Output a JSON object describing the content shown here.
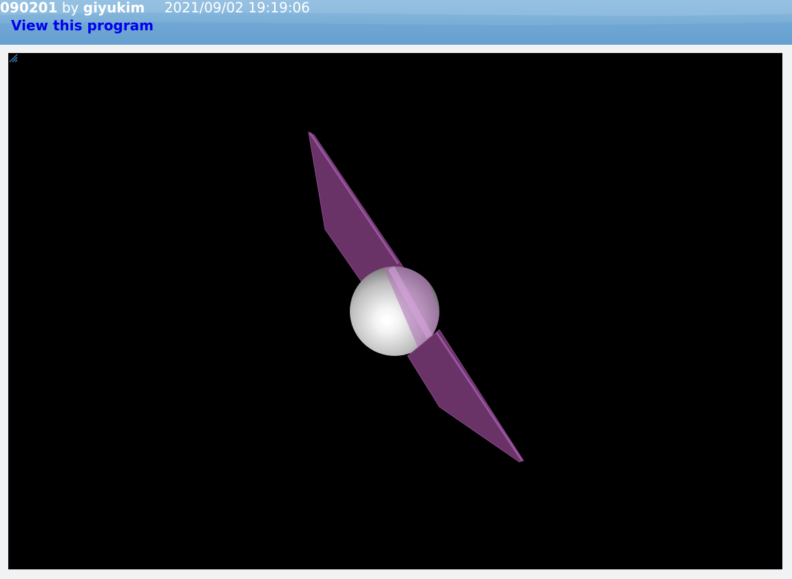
{
  "header": {
    "program_id": "090201",
    "by_text": "by",
    "author": "giyukim",
    "timestamp": "2021/09/02 19:19:06",
    "view_link_label": "View this program"
  },
  "canvas": {
    "background_color": "#000000",
    "plane_color": "#a050a8",
    "sphere_color": "#ffffff",
    "resize_grip_icon": "resize-grip-icon"
  }
}
